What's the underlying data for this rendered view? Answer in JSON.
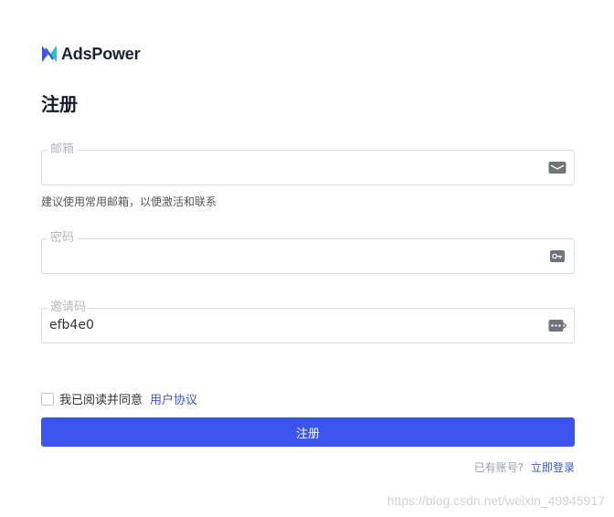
{
  "brand": {
    "name": "AdsPower",
    "logo_icon": "adspower-logo-icon",
    "accent": "#3b55ec"
  },
  "page": {
    "title": "注册"
  },
  "form": {
    "email": {
      "label": "邮箱",
      "value": "",
      "icon": "email-card-icon"
    },
    "email_hint": "建议使用常用邮箱，以便激活和联系",
    "password": {
      "label": "密码",
      "value": "",
      "icon": "key-card-icon"
    },
    "invite": {
      "label": "邀请码",
      "value": "efb4e0",
      "icon": "password-arrow-icon"
    }
  },
  "agreement": {
    "checked": false,
    "text": "我已阅读并同意",
    "link": "用户协议"
  },
  "submit_label": "注册",
  "login": {
    "question": "已有账号?",
    "link": "立即登录"
  },
  "watermark": "https://blog.csdn.net/weixin_49945917"
}
